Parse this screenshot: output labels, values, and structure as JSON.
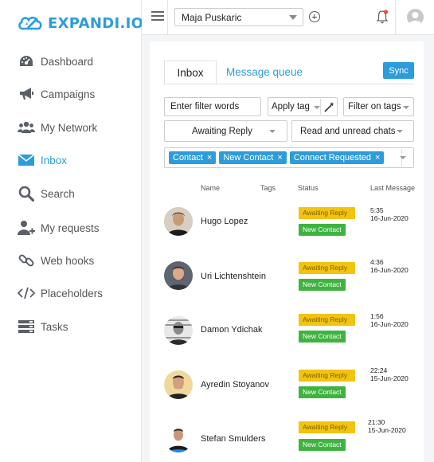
{
  "brand": {
    "name": "EXPANDI.IO",
    "color": "#2d9cdb"
  },
  "sidebar": {
    "items": [
      {
        "label": "Dashboard",
        "icon": "speedometer-icon",
        "active": false
      },
      {
        "label": "Campaigns",
        "icon": "megaphone-icon",
        "active": false
      },
      {
        "label": "My Network",
        "icon": "users-icon",
        "active": false
      },
      {
        "label": "Inbox",
        "icon": "envelope-icon",
        "active": true
      },
      {
        "label": "Search",
        "icon": "search-icon",
        "active": false
      },
      {
        "label": "My requests",
        "icon": "user-add-icon",
        "active": false
      },
      {
        "label": "Web hooks",
        "icon": "link-icon",
        "active": false
      },
      {
        "label": "Placeholders",
        "icon": "code-icon",
        "active": false
      },
      {
        "label": "Tasks",
        "icon": "tasks-icon",
        "active": false
      }
    ]
  },
  "topbar": {
    "account": "Maja Puskaric"
  },
  "inbox": {
    "tabs": [
      "Inbox",
      "Message queue"
    ],
    "sync_label": "Sync",
    "filter_placeholder": "Enter filter words",
    "apply_tag": "Apply tag",
    "filter_on_tags": "Filter on tags",
    "status_select": "Awaiting Reply",
    "read_select": "Read and unread chats",
    "chips": [
      "Contact",
      "New Contact",
      "Connect Requested"
    ],
    "columns": {
      "name": "Name",
      "tags": "Tags",
      "status": "Status",
      "last": "Last Message"
    },
    "rows": [
      {
        "name": "Hugo Lopez",
        "status1": "Awaiting Reply",
        "status2": "New Contact",
        "time": "5:35",
        "date": "16-Jun-2020"
      },
      {
        "name": "Uri Lichtenshtein",
        "status1": "Awaiting Reply",
        "status2": "New Contact",
        "time": "4:36",
        "date": "16-Jun-2020"
      },
      {
        "name": "Damon Ydichak",
        "status1": "Awaiting Reply",
        "status2": "New Contact",
        "time": "1:56",
        "date": "16-Jun-2020"
      },
      {
        "name": "Ayredin Stoyanov",
        "status1": "Awaiting Reply",
        "status2": "New Contact",
        "time": "22:24",
        "date": "15-Jun-2020"
      },
      {
        "name": "Stefan Smulders",
        "status1": "Awaiting Reply",
        "status2": "New Contact",
        "time": "21:30",
        "date": "15-Jun-2020"
      }
    ]
  },
  "colors": {
    "awaiting": "#f2c30f",
    "new_contact": "#3fb33f",
    "accent": "#2d9cdb"
  }
}
